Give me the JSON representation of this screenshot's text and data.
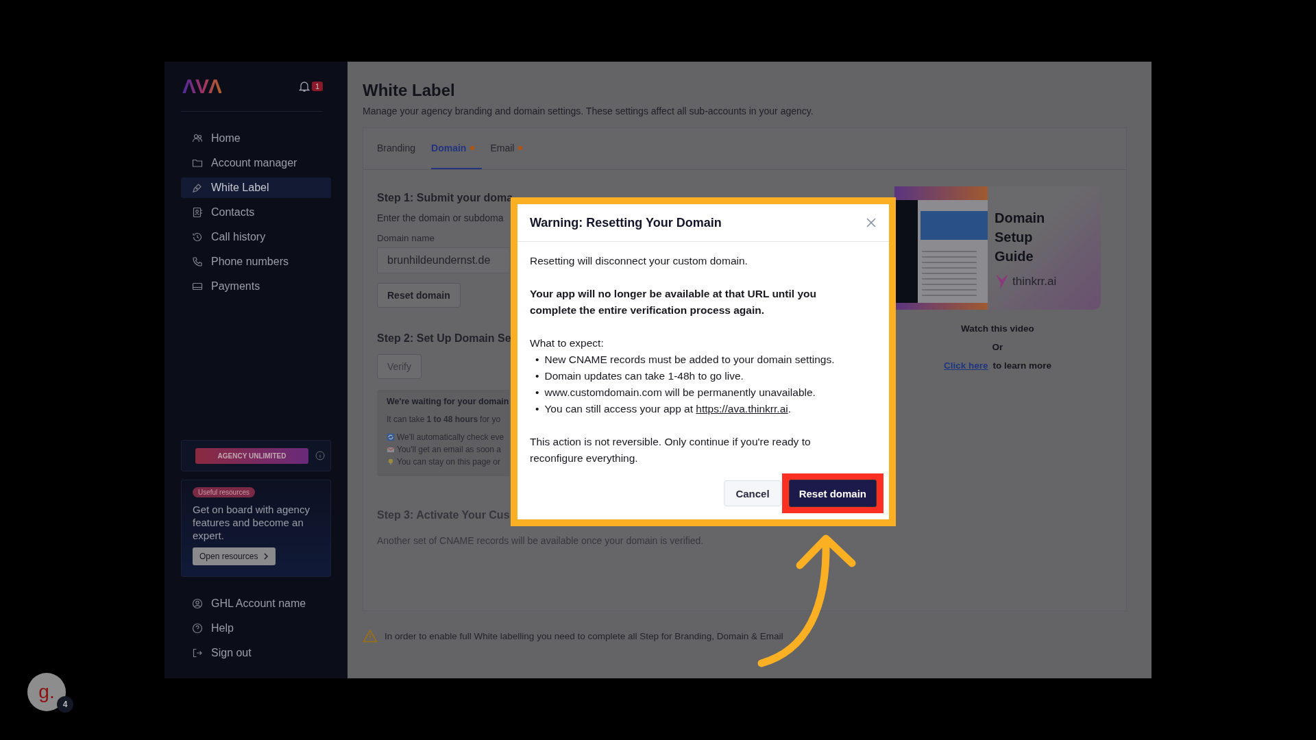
{
  "sidebar": {
    "logo": "ΛVΛ",
    "notification_count": "1",
    "nav": [
      {
        "label": "Home",
        "selected": false
      },
      {
        "label": "Account manager",
        "selected": false
      },
      {
        "label": "White Label",
        "selected": true
      },
      {
        "label": "Contacts",
        "selected": false
      },
      {
        "label": "Call history",
        "selected": false
      },
      {
        "label": "Phone numbers",
        "selected": false
      },
      {
        "label": "Payments",
        "selected": false
      }
    ],
    "plan_badge": "AGENCY UNLIMITED",
    "resources": {
      "tag": "Useful resources",
      "text": "Get on board with agency features and become an expert.",
      "button": "Open resources"
    },
    "footer": [
      {
        "label": "GHL Account name"
      },
      {
        "label": "Help"
      },
      {
        "label": "Sign out"
      }
    ]
  },
  "page": {
    "title": "White Label",
    "subtitle": "Manage your agency branding and domain settings. These settings affect all sub-accounts in your agency."
  },
  "tabs": [
    {
      "label": "Branding",
      "selected": false,
      "pending": false
    },
    {
      "label": "Domain",
      "selected": true,
      "pending": true
    },
    {
      "label": "Email",
      "selected": false,
      "pending": true
    }
  ],
  "step1": {
    "title": "Step 1: Submit your doma",
    "description": "Enter the domain or subdoma",
    "field_label": "Domain name",
    "field_value": "brunhildeundernst.de",
    "button": "Reset domain"
  },
  "step2": {
    "title": "Step 2: Set Up Domain Se",
    "button": {
      "label": "Verify",
      "disabled": true
    }
  },
  "waiting": {
    "title": "We're waiting for your domain",
    "lines": [
      {
        "kind": "text",
        "text": "It can take **1 to 48 hours** for yo"
      },
      {
        "kind": "sync",
        "text": "We'll automatically check eve"
      },
      {
        "kind": "mail",
        "text": "You'll get an email as soon a"
      },
      {
        "kind": "bulb",
        "text": "You can stay on this page or"
      }
    ]
  },
  "step3": {
    "title": "Step 3: Activate Your Cus",
    "description": "Another set of CNAME records will be available once your domain is verified.",
    "disabled": true
  },
  "video": {
    "heading": "Domain Setup Guide",
    "brand": "thinkrr.ai",
    "caption": "Watch this video",
    "or": "Or",
    "link": "Click here",
    "link_suffix": "to learn more"
  },
  "notice": "In order to enable full White labelling you need to complete all Step for Branding, Domain & Email",
  "modal": {
    "title": "Warning: Resetting Your Domain",
    "intro": "Resetting will disconnect your custom domain.",
    "warning": "Your app will no longer be available at that URL until you complete the entire verification process again.",
    "expect_label": "What to expect:",
    "bullets": [
      {
        "marker": "•",
        "text": "New CNAME records must be added to your domain settings."
      },
      {
        "marker": "•",
        "text": "Domain updates can take 1-48h to go live."
      },
      {
        "marker": "•",
        "text": "www.customdomain.com will be permanently unavailable."
      },
      {
        "marker": "•",
        "text": "You can still access your app at ",
        "link": "https://ava.thinkrr.ai",
        "suffix": "."
      }
    ],
    "footnote": "This action is not reversible. Only continue if you're ready to reconfigure everything.",
    "cancel": "Cancel",
    "confirm": "Reset domain"
  },
  "guide_badge": {
    "letter": "g.",
    "count": "4"
  }
}
